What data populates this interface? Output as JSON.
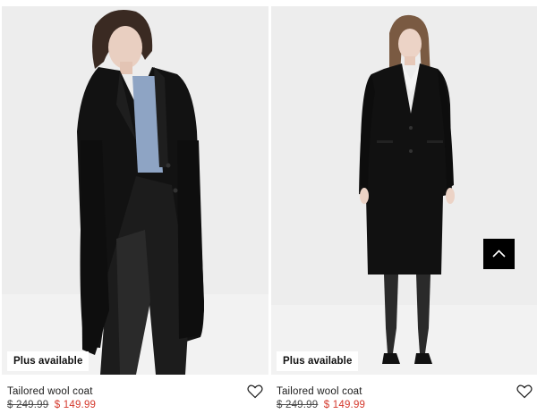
{
  "products": [
    {
      "badge": "Plus available",
      "name": "Tailored wool coat",
      "old_price": "$ 249.99",
      "new_price": "$ 149.99",
      "favorite_icon": "heart-outline-icon"
    },
    {
      "badge": "Plus available",
      "name": "Tailored wool coat",
      "old_price": "$ 249.99",
      "new_price": "$ 149.99",
      "favorite_icon": "heart-outline-icon"
    }
  ],
  "scroll_top": {
    "icon": "chevron-up-icon"
  },
  "colors": {
    "sale_price": "#d4382c",
    "photo_bg": "#ededed",
    "button_bg": "#000000"
  }
}
